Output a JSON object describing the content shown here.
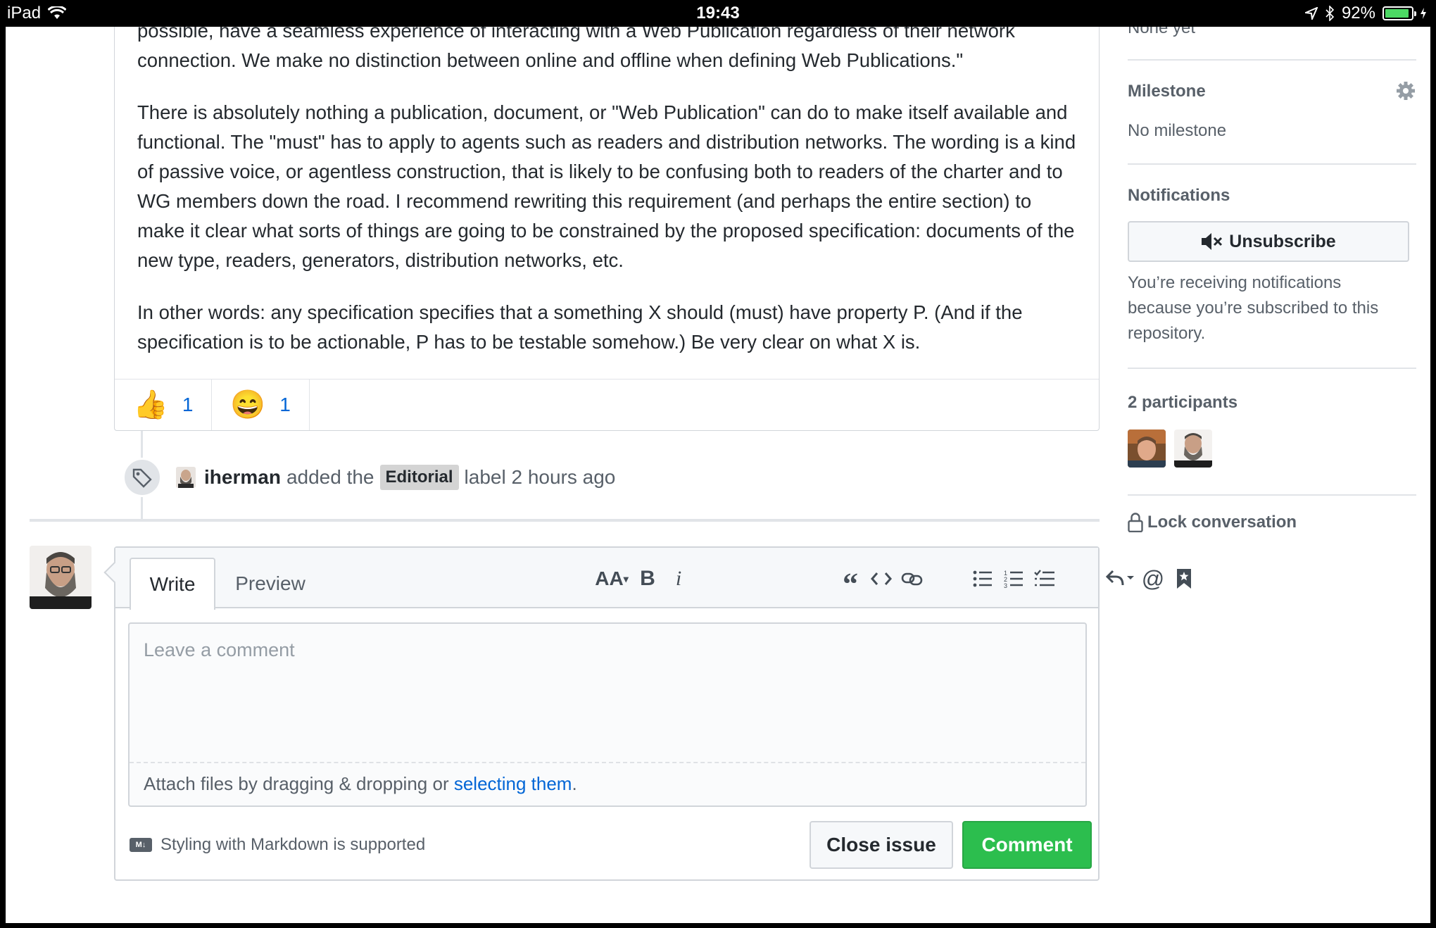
{
  "status_bar": {
    "device": "iPad",
    "time": "19:43",
    "battery": "92%",
    "battery_level": 0.92
  },
  "comment": {
    "paragraph_partial_1": "possible, have a seamless experience of interacting with a Web Publication regardless of their network",
    "paragraph_partial_2": "connection. We make no distinction between online and offline when defining Web Publications.\"",
    "paragraph_2": "There is absolutely nothing a publication, document, or \"Web Publication\" can do to make itself available and functional. The \"must\" has to apply to agents such as readers and distribution networks. The wording is a kind of passive voice, or agentless construction, that is likely to be confusing both to readers of the charter and to WG members down the road. I recommend rewriting this requirement (and perhaps the entire section) to make it clear what sorts of things are going to be constrained by the proposed specification: documents of the new type, readers, generators, distribution networks, etc.",
    "paragraph_3": "In other words: any specification specifies that a something X should (must) have property P. (And if the specification is to be actionable, P has to be testable somehow.) Be very clear on what X is.",
    "reactions": [
      {
        "emoji": "👍",
        "count": "1"
      },
      {
        "emoji": "😄",
        "count": "1"
      }
    ]
  },
  "timeline_event": {
    "author": "iherman",
    "action": "added the",
    "label": "Editorial",
    "suffix": "label 2 hours ago"
  },
  "form": {
    "tab_write": "Write",
    "tab_preview": "Preview",
    "placeholder": "Leave a comment",
    "attach_text": "Attach files by dragging & dropping or ",
    "attach_link": "selecting them",
    "attach_end": ".",
    "markdown_note": "Styling with Markdown is supported",
    "markdown_badge": "M↓",
    "close_button": "Close issue",
    "comment_button": "Comment",
    "toolbar": {
      "header": "AA",
      "bold": "B",
      "italic": "i",
      "quote": "“"
    }
  },
  "sidebar": {
    "projects_partial": "None yet",
    "milestone_title": "Milestone",
    "milestone_value": "No milestone",
    "notifications_title": "Notifications",
    "unsubscribe_button": "Unsubscribe",
    "notifications_text": "You’re receiving notifications because you’re subscribed to this repository.",
    "participants_title": "2 participants",
    "lock_label": "Lock conversation"
  },
  "colors": {
    "link": "#0366d6",
    "comment_button": "#2cbe4e",
    "battery": "#4cd964"
  }
}
